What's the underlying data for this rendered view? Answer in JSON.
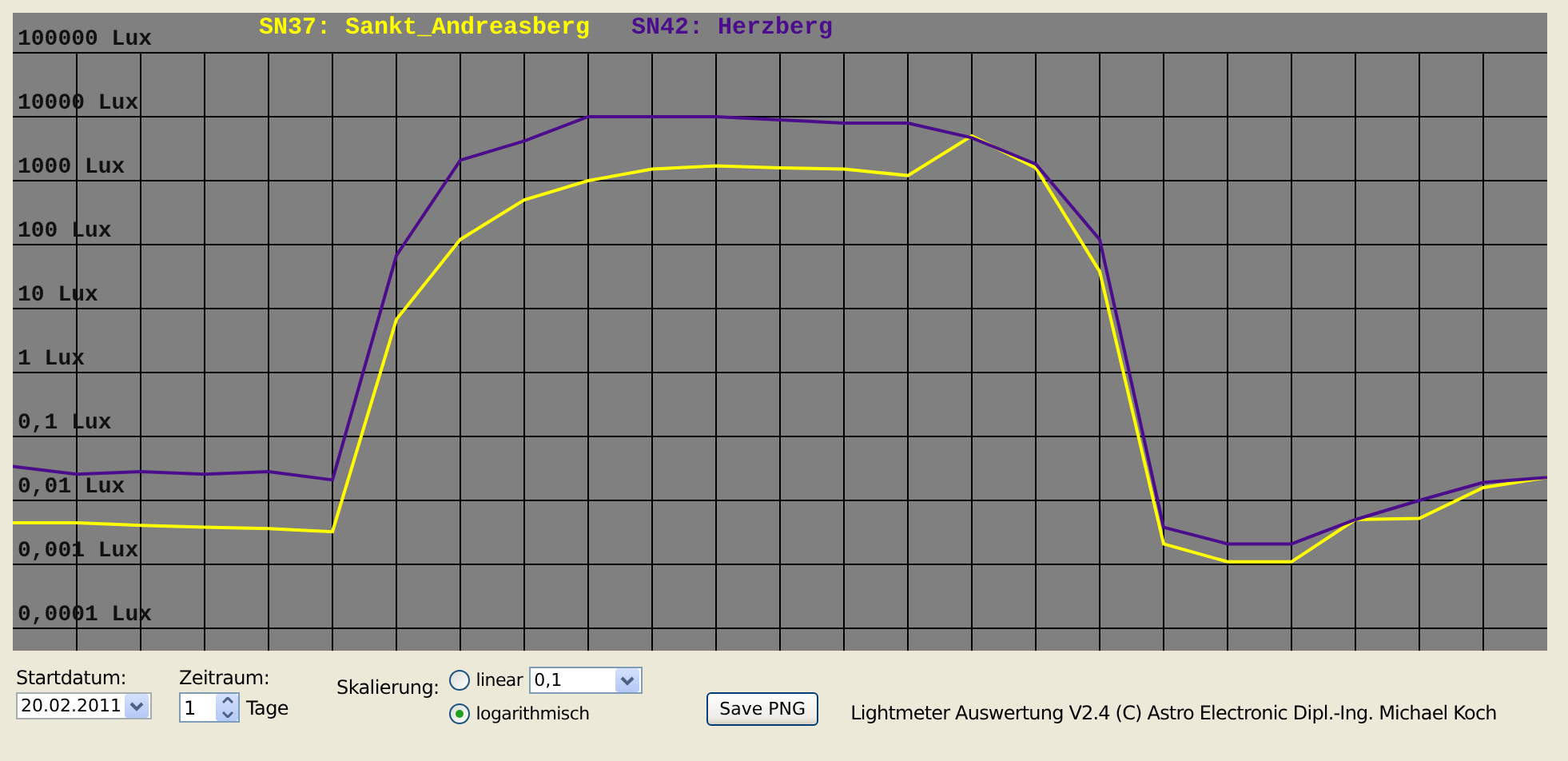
{
  "chart": {
    "legend": [
      {
        "label": "SN37: Sankt_Andreasberg",
        "color": "#ffff00"
      },
      {
        "label": "SN42: Herzberg",
        "color": "#4b0d8c"
      }
    ],
    "y_labels": [
      "100000 Lux",
      "10000 Lux",
      "1000 Lux",
      "100 Lux",
      "10 Lux",
      "1 Lux",
      "0,1 Lux",
      "0,01 Lux",
      "0,001 Lux",
      "0,0001 Lux"
    ]
  },
  "controls": {
    "start_date": {
      "label": "Startdatum:",
      "value": "20.02.2011"
    },
    "period": {
      "label": "Zeitraum:",
      "value": "1",
      "unit": "Tage"
    },
    "scaling": {
      "label": "Skalierung:",
      "options": [
        {
          "label": "linear",
          "selected": false
        },
        {
          "label": "logarithmisch",
          "selected": true
        }
      ],
      "linear_factor": "0,1"
    },
    "save_button": "Save PNG",
    "footer": "Lightmeter Auswertung V2.4  (C) Astro Electronic Dipl.-Ing. Michael Koch"
  }
}
